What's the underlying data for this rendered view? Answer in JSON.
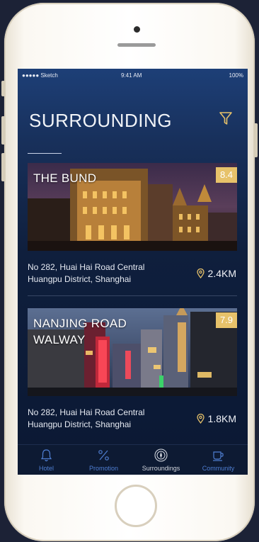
{
  "status_bar": {
    "carrier": "●●●●● Sketch",
    "time": "9:41 AM",
    "battery": "100%"
  },
  "header": {
    "title": "SURROUNDING",
    "filter_icon": "filter-icon"
  },
  "places": [
    {
      "name": "THE BUND",
      "rating": "8.4",
      "address_line1": "No 282, Huai Hai Road Central",
      "address_line2": "Huangpu District, Shanghai",
      "distance": "2.4KM"
    },
    {
      "name": "NANJING ROAD WALWAY",
      "rating": "7.9",
      "address_line1": "No 282, Huai Hai Road Central",
      "address_line2": "Huangpu District, Shanghai",
      "distance": "1.8KM"
    }
  ],
  "tabs": [
    {
      "label": "Hotel",
      "icon": "bell-icon"
    },
    {
      "label": "Promotion",
      "icon": "percent-icon"
    },
    {
      "label": "Surroundings",
      "icon": "compass-icon",
      "active": true
    },
    {
      "label": "Community",
      "icon": "cup-icon"
    }
  ],
  "colors": {
    "accent": "#e7c26a",
    "tab_inactive": "#4f7ed1",
    "background_top": "#1d3f77"
  }
}
